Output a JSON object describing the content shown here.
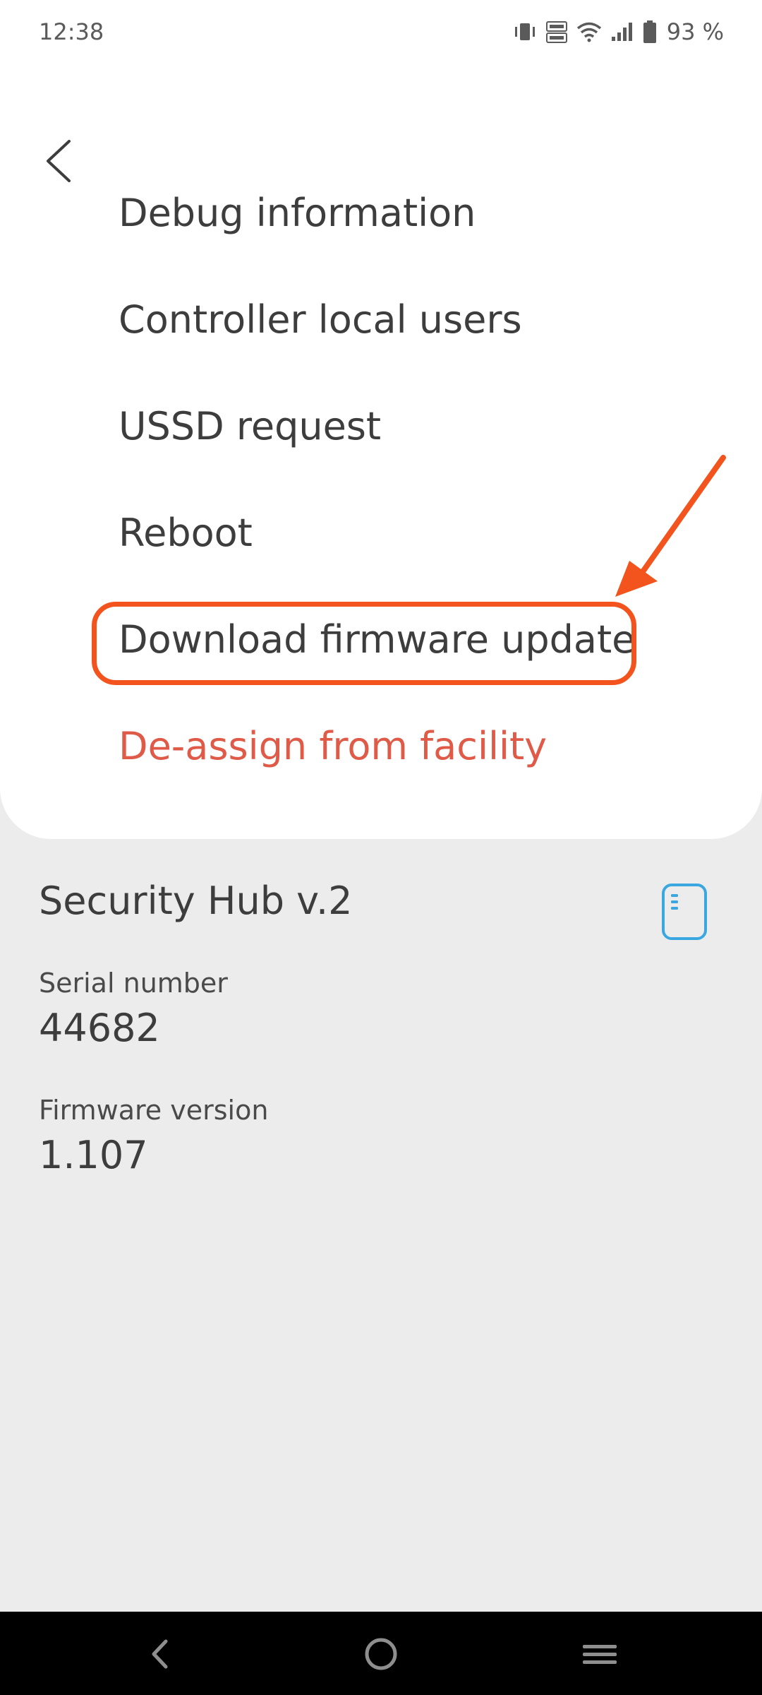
{
  "status_bar": {
    "time": "12:38",
    "battery": "93 %",
    "icons": [
      "vibrate-icon",
      "volte-icon",
      "wifi-icon",
      "signal-icon",
      "battery-icon"
    ]
  },
  "menu": {
    "items": [
      {
        "label": "Debug information"
      },
      {
        "label": "Controller local users"
      },
      {
        "label": "USSD request"
      },
      {
        "label": "Reboot"
      },
      {
        "label": "Download firmware update"
      },
      {
        "label": "De-assign from facility"
      }
    ]
  },
  "device": {
    "title": "Security Hub v.2",
    "serial_label": "Serial number",
    "serial_value": "44682",
    "firmware_label": "Firmware version",
    "firmware_value": "1.107"
  },
  "colors": {
    "danger": "#e05a48",
    "annotation": "#f3531c",
    "device_icon": "#3ba7e0"
  },
  "navigation": {
    "buttons": [
      "back-icon",
      "home-icon",
      "recents-icon"
    ]
  }
}
